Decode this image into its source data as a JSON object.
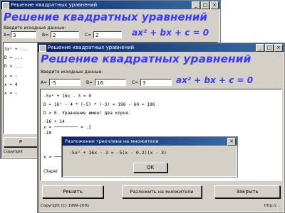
{
  "back_window": {
    "title": "Решение квадратных уравнений",
    "heading": "Решение квадратных уравнений",
    "prompt": "Введите исходные данные:",
    "a_label": "A=",
    "b_label": "B=",
    "c_label": "C=",
    "a_value": "3",
    "b_value": "2",
    "c_value": "2",
    "formula": "ax² + bx + c = 0",
    "lines": [
      "3x² + ...",
      "D = ...",
      "D > ...",
      "x = -",
      "x = 4",
      "x = -"
    ],
    "button_partial": "Р",
    "status_partial": "Copyright"
  },
  "front_window": {
    "title": "Решение квадратных уравнений",
    "heading": "Решение квадратных уравнений",
    "prompt": "Введите исходные данные:",
    "a_label": "A=",
    "b_label": "B=",
    "c_label": "C=",
    "a_value": "-5",
    "b_value": "16",
    "c_value": "3",
    "formula": "ax² + bx + c = 0",
    "lines": [
      "-5x² + 16x - 3 = 0",
      "D = 16² - 4 * (-5) * (-3) = 196 - 60 = 196",
      "D > 0. Уравнение имеет два корня.",
      "         -16 + 14",
      "x =  ─────────  = .2",
      "           -10",
      "x = ─────────  = 3"
    ],
    "bottom_partial": "(Зарег",
    "buttons": {
      "solve": "Решить",
      "factor": "Разложить на множители",
      "close": "Закрыть"
    },
    "status_left": "Copyright (C) 1999-2001",
    "status_right": "http://..."
  },
  "dialog": {
    "title": "Разложение трехчлена на множители",
    "result": "-5x² + 16x - 3 = -5(x - 0.2)(x - 3)",
    "ok": "OK"
  }
}
